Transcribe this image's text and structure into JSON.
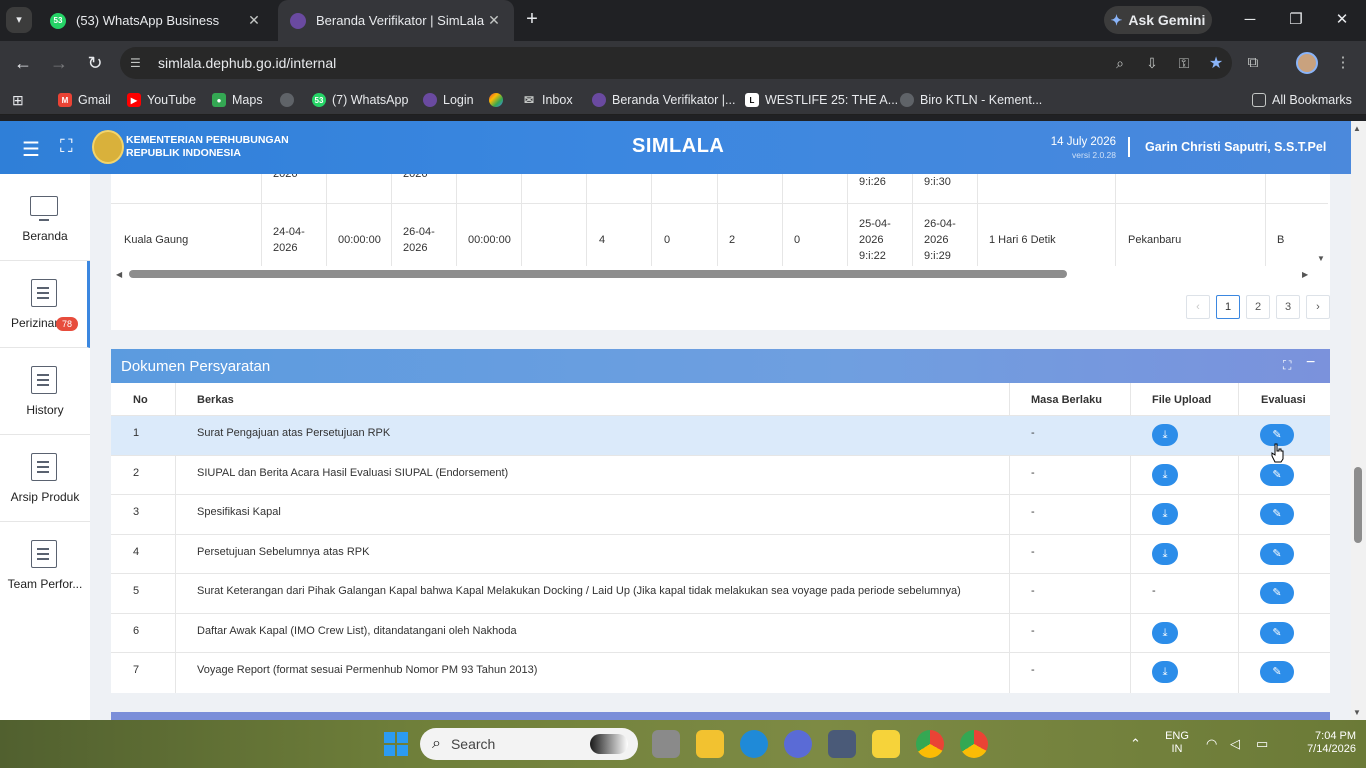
{
  "browser": {
    "tabs": [
      {
        "title": "(53) WhatsApp Business",
        "badge": "53",
        "active": false
      },
      {
        "title": "Beranda Verifikator | SimLala",
        "active": true
      }
    ],
    "gemini_label": "Ask Gemini",
    "url": "simlala.dephub.go.id/internal",
    "bookmarks": [
      {
        "label": "Gmail"
      },
      {
        "label": "YouTube"
      },
      {
        "label": "Maps"
      },
      {
        "label": ""
      },
      {
        "label": "(7) WhatsApp",
        "badge": "53"
      },
      {
        "label": "Login"
      },
      {
        "label": ""
      },
      {
        "label": "Inbox"
      },
      {
        "label": "Beranda Verifikator |..."
      },
      {
        "label": "WESTLIFE 25: THE A..."
      },
      {
        "label": "Biro KTLN - Kement..."
      }
    ],
    "all_bookmarks": "All Bookmarks"
  },
  "header": {
    "ministry_line1": "KEMENTERIAN PERHUBUNGAN",
    "ministry_line2": "REPUBLIK INDONESIA",
    "app_title": "SIMLALA",
    "date": "14 July 2026",
    "version": "versi 2.0.28",
    "user": "Garin Christi Saputri, S.S.T.Pel"
  },
  "sidebar": {
    "items": [
      {
        "label": "Beranda"
      },
      {
        "label": "Perizinan",
        "badge": "78"
      },
      {
        "label": "History"
      },
      {
        "label": "Arsip Produk"
      },
      {
        "label": "Team Perfor..."
      }
    ]
  },
  "top_table": {
    "partial_row": {
      "c1": "2026",
      "c2": "2026",
      "c3": "9:i:26",
      "c4": "9:i:30"
    },
    "row": {
      "location": "Kuala Gaung",
      "date1": "24-04-2026",
      "time1": "00:00:00",
      "date2": "26-04-2026",
      "time2": "00:00:00",
      "n1": "4",
      "n2": "0",
      "n3": "2",
      "n4": "0",
      "dt1": "25-04-2026 9:i:22",
      "dt2": "26-04-2026 9:i:29",
      "duration": "1 Hari 6 Detik",
      "city": "Pekanbaru",
      "last": "B"
    },
    "pagination": {
      "prev": "‹",
      "pages": [
        "1",
        "2",
        "3"
      ],
      "next": "›"
    }
  },
  "documents": {
    "title": "Dokumen Persyaratan",
    "columns": {
      "no": "No",
      "berkas": "Berkas",
      "masa": "Masa Berlaku",
      "file": "File Upload",
      "evaluasi": "Evaluasi"
    },
    "rows": [
      {
        "no": "1",
        "berkas": "Surat Pengajuan atas Persetujuan RPK",
        "masa": "-",
        "file": "download"
      },
      {
        "no": "2",
        "berkas": "SIUPAL dan Berita Acara Hasil Evaluasi SIUPAL (Endorsement)",
        "masa": "-",
        "file": "download"
      },
      {
        "no": "3",
        "berkas": "Spesifikasi Kapal",
        "masa": "-",
        "file": "download"
      },
      {
        "no": "4",
        "berkas": "Persetujuan Sebelumnya atas RPK",
        "masa": "-",
        "file": "download"
      },
      {
        "no": "5",
        "berkas": "Surat Keterangan dari Pihak Galangan Kapal bahwa Kapal Melakukan Docking / Laid Up (Jika kapal tidak melakukan sea voyage pada periode sebelumnya)",
        "masa": "-",
        "file": "-"
      },
      {
        "no": "6",
        "berkas": "Daftar Awak Kapal (IMO Crew List), ditandatangani oleh Nakhoda",
        "masa": "-",
        "file": "download"
      },
      {
        "no": "7",
        "berkas": "Voyage Report (format sesuai Permenhub Nomor PM 93 Tahun 2013)",
        "masa": "-",
        "file": "download"
      }
    ]
  },
  "taskbar": {
    "search_placeholder": "Search",
    "lang_line1": "ENG",
    "lang_line2": "IN",
    "time": "7:04 PM",
    "date": "7/14/2026"
  },
  "colors": {
    "primary": "#2c8de9",
    "header_blue": "#3b87e0",
    "badge_red": "#e74c3c"
  }
}
